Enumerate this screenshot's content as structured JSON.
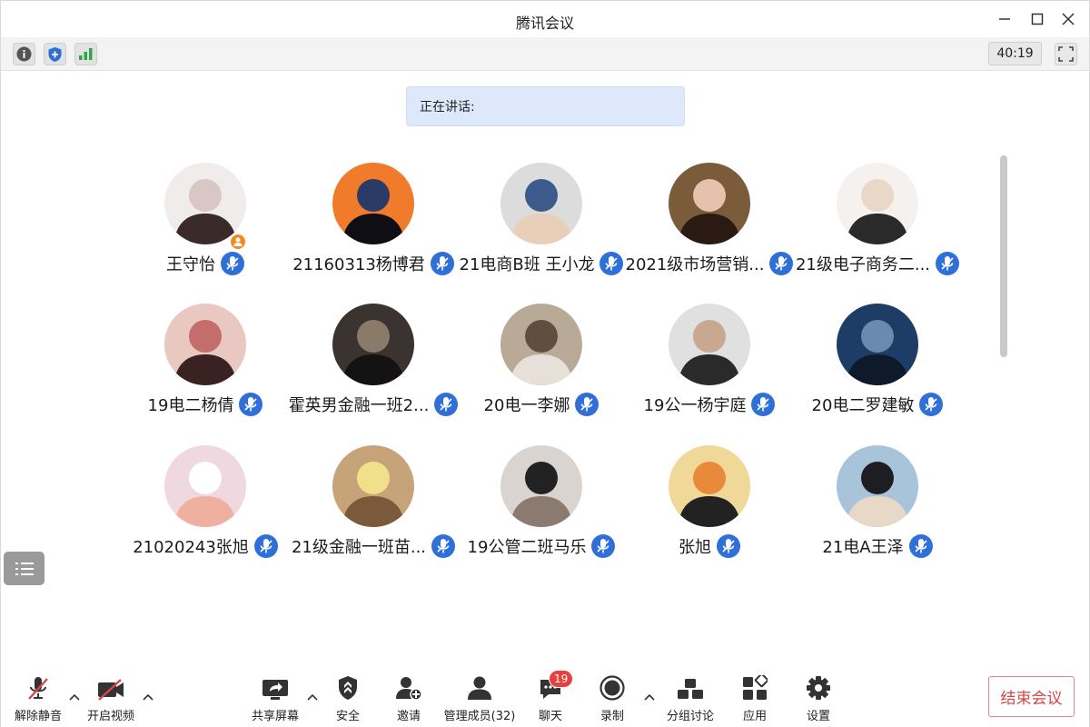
{
  "window": {
    "title": "腾讯会议"
  },
  "topbar": {
    "info_icon": "info-icon",
    "security_icon": "shield-icon",
    "signal_icon": "signal-bars-icon",
    "timer": "40:19",
    "fullscreen_icon": "fullscreen-icon"
  },
  "speaking": {
    "label": "正在讲话:"
  },
  "participants": [
    {
      "name": "王守怡",
      "host": true
    },
    {
      "name": "21160313杨博君"
    },
    {
      "name": "21电商B班 王小龙"
    },
    {
      "name": "2021级市场营销..."
    },
    {
      "name": "21级电子商务二..."
    },
    {
      "name": "19电二杨倩"
    },
    {
      "name": "霍英男金融一班2..."
    },
    {
      "name": "20电一李娜"
    },
    {
      "name": "19公一杨宇庭"
    },
    {
      "name": "20电二罗建敏"
    },
    {
      "name": "21020243张旭"
    },
    {
      "name": "21级金融一班苗..."
    },
    {
      "name": "19公管二班马乐"
    },
    {
      "name": "张旭"
    },
    {
      "name": "21电A王泽"
    }
  ],
  "colors": {
    "mic_badge": "#2f6fd8",
    "host_badge": "#f08a24",
    "end_button": "#d64545",
    "chat_badge": "#e64040"
  },
  "toolbar": {
    "unmute": "解除静音",
    "start_video": "开启视频",
    "share_screen": "共享屏幕",
    "security": "安全",
    "invite": "邀请",
    "manage_members": "管理成员(32)",
    "chat": "聊天",
    "chat_count": "19",
    "record": "录制",
    "breakout": "分组讨论",
    "apps": "应用",
    "settings": "设置",
    "end_meeting": "结束会议"
  }
}
